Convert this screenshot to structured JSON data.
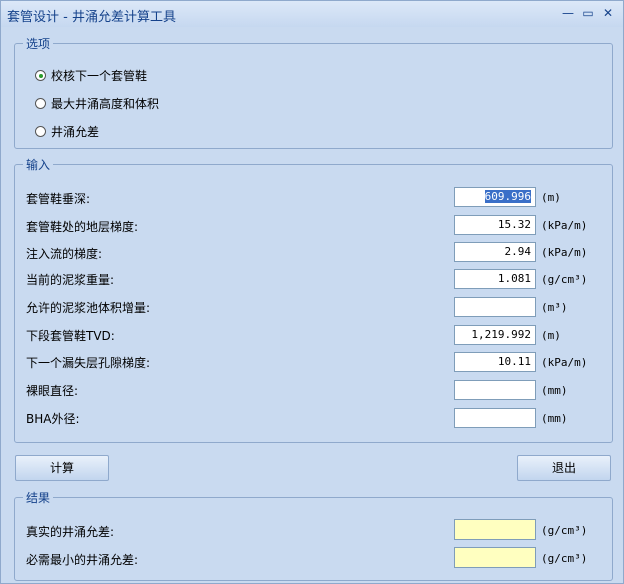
{
  "window": {
    "title": "套管设计 - 井涌允差计算工具",
    "minimize": "—",
    "maximize": "▭",
    "close": "✕"
  },
  "options": {
    "legend": "选项",
    "items": [
      {
        "label": "校核下一个套管鞋",
        "checked": true
      },
      {
        "label": "最大井涌高度和体积",
        "checked": false
      },
      {
        "label": "井涌允差",
        "checked": false
      }
    ]
  },
  "input": {
    "legend": "输入",
    "fields": [
      {
        "label": "套管鞋垂深:",
        "value": "609.996",
        "unit": "(m)"
      },
      {
        "label": "套管鞋处的地层梯度:",
        "value": "15.32",
        "unit": "(kPa/m)"
      },
      {
        "label": "注入流的梯度:",
        "value": "2.94",
        "unit": "(kPa/m)"
      },
      {
        "label": "当前的泥浆重量:",
        "value": "1.081",
        "unit": "(g/cm³)"
      },
      {
        "label": "允许的泥浆池体积增量:",
        "value": "",
        "unit": "(m³)"
      },
      {
        "label": "下段套管鞋TVD:",
        "value": "1,219.992",
        "unit": "(m)"
      },
      {
        "label": "下一个漏失层孔隙梯度:",
        "value": "10.11",
        "unit": "(kPa/m)"
      },
      {
        "label": "裸眼直径:",
        "value": "",
        "unit": "(mm)"
      },
      {
        "label": "BHA外径:",
        "value": "",
        "unit": "(mm)"
      }
    ]
  },
  "buttons": {
    "calculate": "计算",
    "exit": "退出"
  },
  "results": {
    "legend": "结果",
    "fields": [
      {
        "label": "真实的井涌允差:",
        "value": "",
        "unit": "(g/cm³)"
      },
      {
        "label": "必需最小的井涌允差:",
        "value": "",
        "unit": "(g/cm³)"
      }
    ]
  }
}
